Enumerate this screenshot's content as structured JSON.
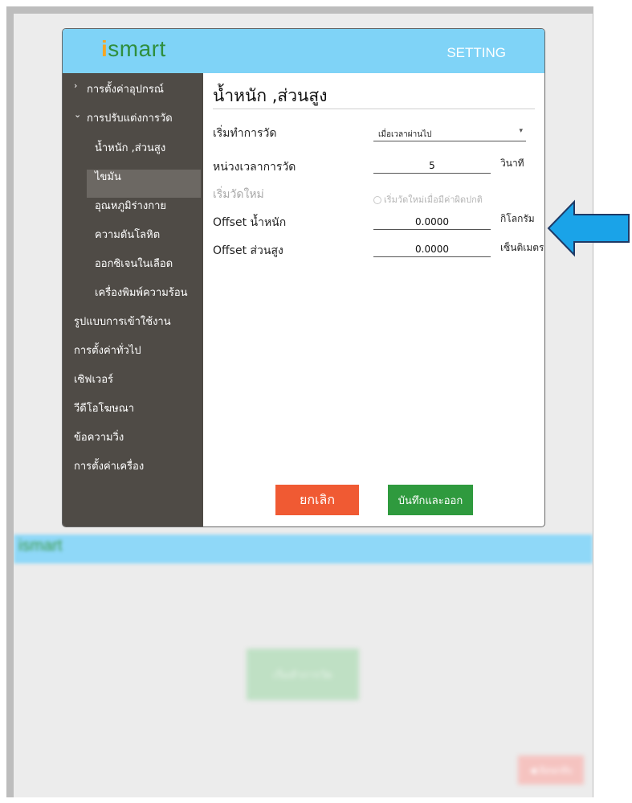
{
  "app": {
    "logo_text": "smart",
    "logo_i": "i",
    "header_title": "SETTING",
    "accent_color": "#7fd3f7",
    "sidebar_color": "#4f4b46"
  },
  "sidebar": {
    "items": [
      {
        "label": "การตั้งค่าอุปกรณ์",
        "bullet": "›"
      },
      {
        "label": "การปรับแต่งการวัด",
        "bullet": "⌄"
      },
      {
        "label": "น้ำหนัก ,ส่วนสูง",
        "selected": true
      },
      {
        "label": "ไขมัน"
      },
      {
        "label": "อุณหภูมิร่างกาย"
      },
      {
        "label": "ความดันโลหิต"
      },
      {
        "label": "ออกซิเจนในเลือด"
      },
      {
        "label": "เครื่องพิมพ์ความร้อน"
      },
      {
        "label": "รูปแบบการเข้าใช้งาน"
      },
      {
        "label": "การตั้งค่าทั่วไป"
      },
      {
        "label": "เซิฟเวอร์"
      },
      {
        "label": "วีดีโอโฆษณา"
      },
      {
        "label": "ข้อความวิ่ง"
      },
      {
        "label": "การตั้งค่าเครื่อง"
      }
    ]
  },
  "form": {
    "title": "น้ำหนัก ,ส่วนสูง",
    "start_label": "เริ่มทำการวัด",
    "start_value": "เมื่อเวลาผ่านไป",
    "interval_label": "หน่วงเวลาการวัด",
    "interval_value": "5",
    "interval_unit": "วินาที",
    "restart_label": "เริ่มวัดใหม่",
    "restart_option": "เริ่มวัดใหม่เมื่อมีค่าผิดปกติ",
    "weight_offset_label": "Offset น้ำหนัก",
    "weight_offset_value": "0.0000",
    "weight_unit": "กิโลกรัม",
    "height_offset_label": "Offset ส่วนสูง",
    "height_offset_value": "0.0000",
    "height_unit": "เซ็นติเมตร"
  },
  "buttons": {
    "cancel": "ยกเลิก",
    "save": "บันทึกและออก"
  },
  "background": {
    "logo_text": "ismart",
    "start_button": "เริ่มทำการวัด",
    "back_button": "◀ ย้อนกลับ"
  },
  "annotation": {
    "arrow_color": "#1aa3e8"
  }
}
